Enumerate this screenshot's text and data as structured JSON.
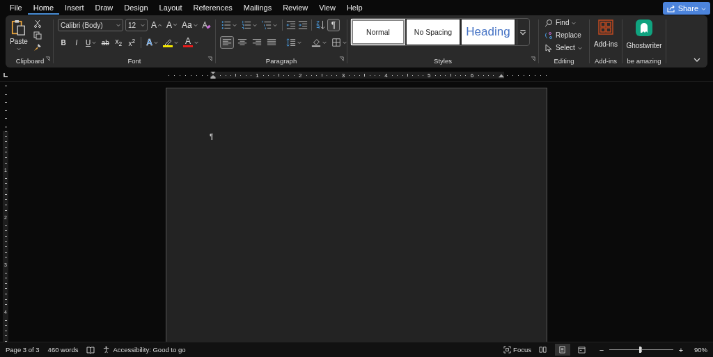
{
  "menu": [
    {
      "label": "File",
      "selected": false
    },
    {
      "label": "Home",
      "selected": true
    },
    {
      "label": "Insert",
      "selected": false
    },
    {
      "label": "Draw",
      "selected": false
    },
    {
      "label": "Design",
      "selected": false
    },
    {
      "label": "Layout",
      "selected": false
    },
    {
      "label": "References",
      "selected": false
    },
    {
      "label": "Mailings",
      "selected": false
    },
    {
      "label": "Review",
      "selected": false
    },
    {
      "label": "View",
      "selected": false
    },
    {
      "label": "Help",
      "selected": false
    }
  ],
  "share": {
    "label": "Share"
  },
  "clipboard": {
    "paste": "Paste",
    "group": "Clipboard"
  },
  "font": {
    "name": "Calibri (Body)",
    "size": "12",
    "group": "Font",
    "top_buttons": [
      {
        "kind": "grow",
        "label": "A"
      },
      {
        "kind": "shrink",
        "label": "A"
      },
      {
        "kind": "case",
        "label": "Aa"
      }
    ],
    "format_buttons": [
      {
        "kind": "bold",
        "label": "B"
      },
      {
        "kind": "italic",
        "label": "I"
      },
      {
        "kind": "underline",
        "label": "U"
      },
      {
        "kind": "strike",
        "label": "ab"
      },
      {
        "kind": "sub",
        "label": "x$_{2}$"
      },
      {
        "kind": "sup",
        "label": "x$^{2}$"
      }
    ],
    "color_buttons": [
      {
        "kind": "effects",
        "label": "A",
        "color": "#3b8ee8"
      },
      {
        "kind": "highlight",
        "color": "#f2e600"
      },
      {
        "kind": "fontcolor",
        "label": "A",
        "color": "#e81c1c"
      }
    ]
  },
  "paragraph": {
    "group": "Paragraph",
    "show_marks": {
      "label": "¶",
      "on": true
    },
    "alignment": [
      {
        "selected": true
      },
      {
        "selected": false
      },
      {
        "selected": false
      },
      {
        "selected": false
      }
    ]
  },
  "styles": {
    "group": "Styles",
    "items": [
      {
        "label": "Normal",
        "kind": "normal",
        "selected": true
      },
      {
        "label": "No Spacing",
        "kind": "nospacing",
        "selected": false
      },
      {
        "label": "Heading",
        "kind": "heading",
        "selected": false
      }
    ]
  },
  "editing": {
    "group": "Editing",
    "items": [
      {
        "label": "Find",
        "kind": "find"
      },
      {
        "label": "Replace",
        "kind": "replace"
      },
      {
        "label": "Select",
        "kind": "select"
      }
    ]
  },
  "addins": {
    "label": "Add-ins",
    "group": "Add-ins"
  },
  "ghostwriter": {
    "label": "Ghostwriter",
    "group": "be amazing"
  },
  "ruler": {
    "numbers": [
      "1",
      "2",
      "3",
      "4",
      "5",
      "6"
    ]
  },
  "vertical_ruler": {
    "numbers": [
      "1",
      "2",
      "3",
      "4"
    ]
  },
  "document": {
    "mark": "¶"
  },
  "status_bar": {
    "page": "Page 3 of 3",
    "words": "460 words",
    "accessibility": "Accessibility: Good to go",
    "focus": "Focus",
    "views": [
      {
        "selected": false
      },
      {
        "selected": true
      },
      {
        "selected": false
      }
    ],
    "zoom_out": "−",
    "zoom_in": "+",
    "zoom": {
      "level": 0.48
    },
    "zoom_text": "90%"
  }
}
